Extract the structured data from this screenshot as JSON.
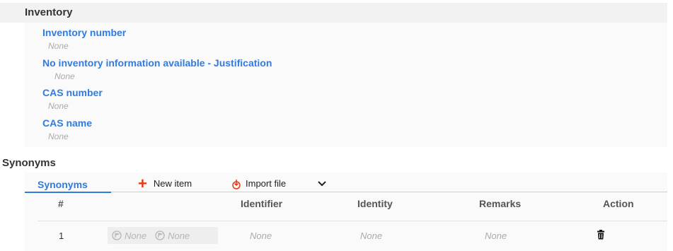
{
  "inventory": {
    "title": "Inventory",
    "fields": [
      {
        "label": "Inventory number",
        "value": "None"
      },
      {
        "label": "No inventory information available - Justification",
        "value": "None"
      },
      {
        "label": "CAS number",
        "value": "None"
      },
      {
        "label": "CAS name",
        "value": "None"
      }
    ]
  },
  "synonyms": {
    "title": "Synonyms",
    "tab_label": "Synonyms",
    "new_item_label": "New item",
    "import_file_label": "Import file",
    "columns": [
      "#",
      "Identifier",
      "Identity",
      "Remarks",
      "Action"
    ],
    "rows": [
      {
        "index": "1",
        "chip_1": "None",
        "chip_2": "None",
        "identifier": "None",
        "identity": "None",
        "remarks": "None"
      }
    ]
  },
  "colors": {
    "accent": "#2f7be0",
    "add": "#e03a12",
    "header_bg": "#f2f2f2"
  },
  "icons": {
    "add": "plus-icon",
    "import": "import-file-icon",
    "dropdown": "chevron-down-icon",
    "delete": "trash-icon",
    "chip": "flag-circle-icon"
  }
}
